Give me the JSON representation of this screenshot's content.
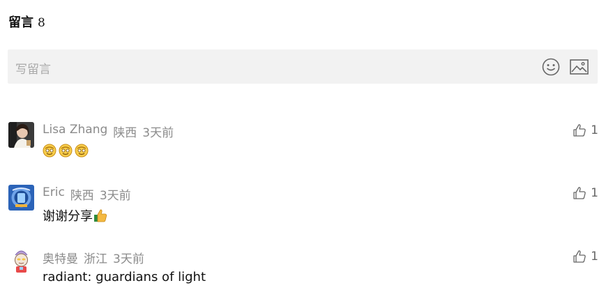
{
  "header": {
    "title": "留言",
    "count": "8"
  },
  "compose": {
    "placeholder": "写留言",
    "emoji_icon": "smiley-face-icon",
    "image_icon": "image-icon"
  },
  "comments": [
    {
      "author": "Lisa Zhang",
      "location": "陕西",
      "time": "3天前",
      "content": "",
      "content_emojis": [
        "emoji-icon",
        "emoji-icon",
        "emoji-icon"
      ],
      "likes": "1"
    },
    {
      "author": "Eric",
      "location": "陕西",
      "time": "3天前",
      "content": "谢谢分享",
      "content_emojis": [
        "thumbs-up-emoji"
      ],
      "likes": "1"
    },
    {
      "author": "奥特曼",
      "location": "浙江",
      "time": "3天前",
      "content": "radiant: guardians of light",
      "content_emojis": [],
      "likes": "1"
    }
  ],
  "colors": {
    "meta_gray": "#8b8b8b",
    "compose_bg": "#f2f2f2",
    "placeholder_gray": "#a8a8a8"
  }
}
